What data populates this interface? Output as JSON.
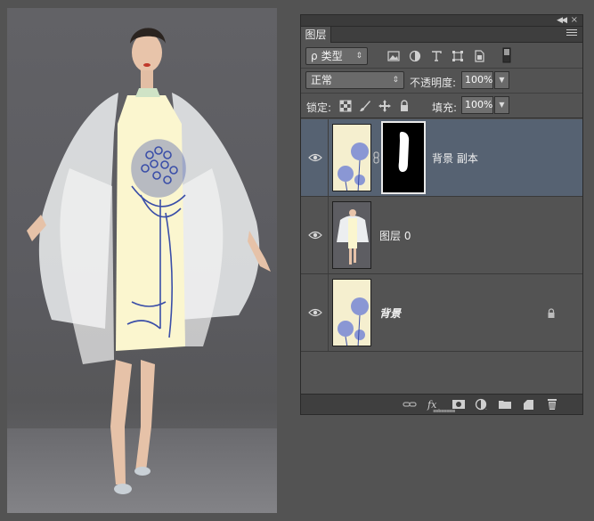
{
  "panel": {
    "tab_label": "图层",
    "filter": {
      "label": "类型",
      "search_glyph": "ρ"
    },
    "blend_mode": "正常",
    "opacity_label": "不透明度:",
    "opacity_value": "100%",
    "lock_label": "锁定:",
    "fill_label": "填充:",
    "fill_value": "100%",
    "layers": [
      {
        "name": "背景 副本",
        "selected": true,
        "has_mask": true,
        "locked": false,
        "visible": true
      },
      {
        "name": "图层 0",
        "selected": false,
        "has_mask": false,
        "locked": false,
        "visible": true
      },
      {
        "name": "背景",
        "selected": false,
        "has_mask": false,
        "locked": true,
        "visible": true,
        "italic": true
      }
    ]
  },
  "colors": {
    "selection": "#566272",
    "panel_bg": "#535353",
    "dress": "#fbf6cf",
    "lotus_blue": "#3a4ea8"
  }
}
